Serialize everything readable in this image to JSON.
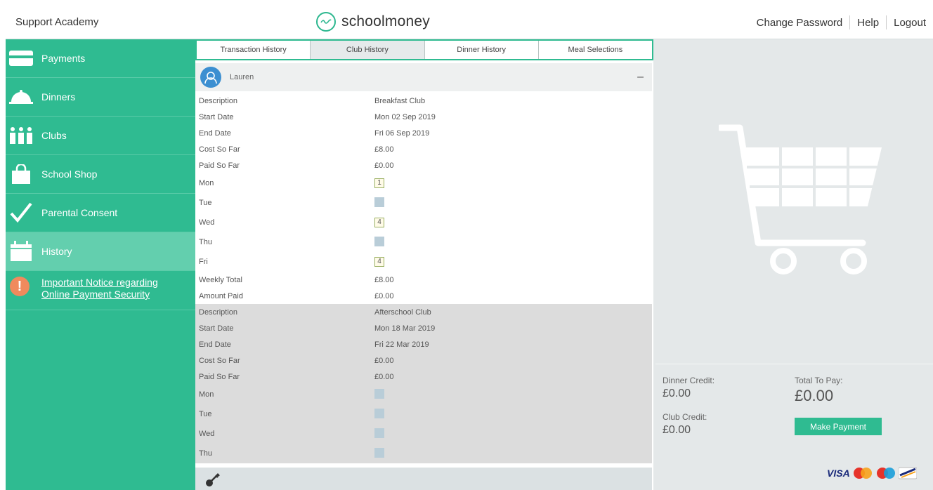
{
  "header": {
    "school_name": "Support Academy",
    "brand_name": "schoolmoney",
    "links": [
      "Change Password",
      "Help",
      "Logout"
    ]
  },
  "sidebar": {
    "items": [
      {
        "label": "Payments",
        "icon": "card-icon"
      },
      {
        "label": "Dinners",
        "icon": "cloche-icon"
      },
      {
        "label": "Clubs",
        "icon": "people-icon"
      },
      {
        "label": "School Shop",
        "icon": "shopping-bag-icon"
      },
      {
        "label": "Parental Consent",
        "icon": "checkmark-icon"
      },
      {
        "label": "History",
        "icon": "calendar-icon",
        "active": true
      }
    ],
    "notice": {
      "line1": "Important Notice regarding",
      "line2": "Online Payment Security"
    }
  },
  "tabs": [
    "Transaction History",
    "Club History",
    "Dinner History",
    "Meal Selections"
  ],
  "active_tab": "Club History",
  "child": {
    "name": "Lauren",
    "collapse": "–"
  },
  "records": [
    {
      "description": "Breakfast Club",
      "start_date": "Mon 02 Sep 2019",
      "end_date": "Fri 06 Sep 2019",
      "cost_so_far": "£8.00",
      "paid_so_far": "£0.00",
      "days": {
        "Mon": "1",
        "Tue": "",
        "Wed": "4",
        "Thu": "",
        "Fri": "4"
      },
      "weekly_total": "£8.00",
      "amount_paid": "£0.00"
    },
    {
      "description": "Afterschool Club",
      "start_date": "Mon 18 Mar 2019",
      "end_date": "Fri 22 Mar 2019",
      "cost_so_far": "£0.00",
      "paid_so_far": "£0.00",
      "days": {
        "Mon": "",
        "Tue": "",
        "Wed": "",
        "Thu": ""
      }
    }
  ],
  "labels": {
    "description": "Description",
    "start_date": "Start Date",
    "end_date": "End Date",
    "cost_so_far": "Cost So Far",
    "paid_so_far": "Paid So Far",
    "mon": "Mon",
    "tue": "Tue",
    "wed": "Wed",
    "thu": "Thu",
    "fri": "Fri",
    "weekly_total": "Weekly Total",
    "amount_paid": "Amount Paid"
  },
  "payment": {
    "dinner_credit_label": "Dinner Credit:",
    "dinner_credit": "£0.00",
    "club_credit_label": "Club Credit:",
    "club_credit": "£0.00",
    "total_label": "Total To Pay:",
    "total": "£0.00",
    "button": "Make Payment",
    "card_brands": [
      "VISA",
      "Mastercard",
      "Maestro",
      "Card"
    ]
  },
  "colors": {
    "accent": "#2fbb91",
    "notice": "#f08a5d",
    "avatar": "#3c8fd1"
  }
}
